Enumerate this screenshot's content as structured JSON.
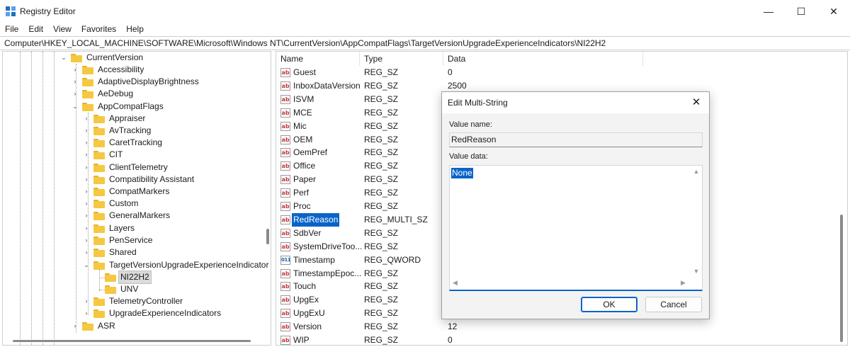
{
  "window": {
    "title": "Registry Editor",
    "minimize_glyph": "—",
    "maximize_glyph": "☐",
    "close_glyph": "✕"
  },
  "menu": [
    "File",
    "Edit",
    "View",
    "Favorites",
    "Help"
  ],
  "address": "Computer\\HKEY_LOCAL_MACHINE\\SOFTWARE\\Microsoft\\Windows NT\\CurrentVersion\\AppCompatFlags\\TargetVersionUpgradeExperienceIndicators\\NI22H2",
  "tree": [
    {
      "label": "CurrentVersion",
      "expanded": true
    },
    {
      "label": "Accessibility",
      "expanded": false
    },
    {
      "label": "AdaptiveDisplayBrightness",
      "expanded": false
    },
    {
      "label": "AeDebug",
      "expanded": false
    },
    {
      "label": "AppCompatFlags",
      "expanded": true
    },
    {
      "label": "Appraiser",
      "expanded": false
    },
    {
      "label": "AvTracking",
      "expanded": false
    },
    {
      "label": "CaretTracking",
      "expanded": false
    },
    {
      "label": "CIT",
      "expanded": false
    },
    {
      "label": "ClientTelemetry",
      "expanded": false
    },
    {
      "label": "Compatibility Assistant",
      "expanded": false
    },
    {
      "label": "CompatMarkers",
      "expanded": false
    },
    {
      "label": "Custom",
      "expanded": false
    },
    {
      "label": "GeneralMarkers",
      "expanded": false
    },
    {
      "label": "Layers",
      "expanded": false
    },
    {
      "label": "PenService",
      "expanded": false
    },
    {
      "label": "Shared",
      "expanded": false
    },
    {
      "label": "TargetVersionUpgradeExperienceIndicator",
      "expanded": true
    },
    {
      "label": "NI22H2",
      "selected": true
    },
    {
      "label": "UNV"
    },
    {
      "label": "TelemetryController",
      "expanded": false
    },
    {
      "label": "UpgradeExperienceIndicators",
      "expanded": false
    },
    {
      "label": "ASR",
      "expanded": false
    }
  ],
  "columns": {
    "name": "Name",
    "type": "Type",
    "data": "Data"
  },
  "values": [
    {
      "name": "Guest",
      "type": "REG_SZ",
      "data": "0",
      "icon": "string-value-icon"
    },
    {
      "name": "InboxDataVersion",
      "type": "REG_SZ",
      "data": "2500",
      "icon": "string-value-icon"
    },
    {
      "name": "ISVM",
      "type": "REG_SZ",
      "data": "",
      "icon": "string-value-icon"
    },
    {
      "name": "MCE",
      "type": "REG_SZ",
      "data": "",
      "icon": "string-value-icon"
    },
    {
      "name": "Mic",
      "type": "REG_SZ",
      "data": "",
      "icon": "string-value-icon"
    },
    {
      "name": "OEM",
      "type": "REG_SZ",
      "data": "",
      "icon": "string-value-icon"
    },
    {
      "name": "OemPref",
      "type": "REG_SZ",
      "data": "",
      "icon": "string-value-icon"
    },
    {
      "name": "Office",
      "type": "REG_SZ",
      "data": "",
      "icon": "string-value-icon"
    },
    {
      "name": "Paper",
      "type": "REG_SZ",
      "data": "",
      "icon": "string-value-icon"
    },
    {
      "name": "Perf",
      "type": "REG_SZ",
      "data": "",
      "icon": "string-value-icon"
    },
    {
      "name": "Proc",
      "type": "REG_SZ",
      "data": "",
      "icon": "string-value-icon"
    },
    {
      "name": "RedReason",
      "type": "REG_MULTI_SZ",
      "data": "",
      "icon": "string-value-icon",
      "selected": true
    },
    {
      "name": "SdbVer",
      "type": "REG_SZ",
      "data": "",
      "icon": "string-value-icon"
    },
    {
      "name": "SystemDriveToo...",
      "type": "REG_SZ",
      "data": "",
      "icon": "string-value-icon"
    },
    {
      "name": "Timestamp",
      "type": "REG_QWORD",
      "data": "",
      "icon": "binary-value-icon"
    },
    {
      "name": "TimestampEpoc...",
      "type": "REG_SZ",
      "data": "",
      "icon": "string-value-icon"
    },
    {
      "name": "Touch",
      "type": "REG_SZ",
      "data": "",
      "icon": "string-value-icon"
    },
    {
      "name": "UpgEx",
      "type": "REG_SZ",
      "data": "",
      "icon": "string-value-icon"
    },
    {
      "name": "UpgExU",
      "type": "REG_SZ",
      "data": "",
      "icon": "string-value-icon"
    },
    {
      "name": "Version",
      "type": "REG_SZ",
      "data": "12",
      "icon": "string-value-icon"
    },
    {
      "name": "WIP",
      "type": "REG_SZ",
      "data": "0",
      "icon": "string-value-icon"
    }
  ],
  "icon_glyphs": {
    "string": "ab",
    "binary": "011"
  },
  "dialog": {
    "title": "Edit Multi-String",
    "close_glyph": "✕",
    "value_name_label": "Value name:",
    "value_name": "RedReason",
    "value_data_label": "Value data:",
    "value_data": "None",
    "ok_label": "OK",
    "cancel_label": "Cancel"
  },
  "colors": {
    "selection": "#0a64c8",
    "folder": "#f5c842",
    "accent_icon": "#1e6fc0"
  }
}
